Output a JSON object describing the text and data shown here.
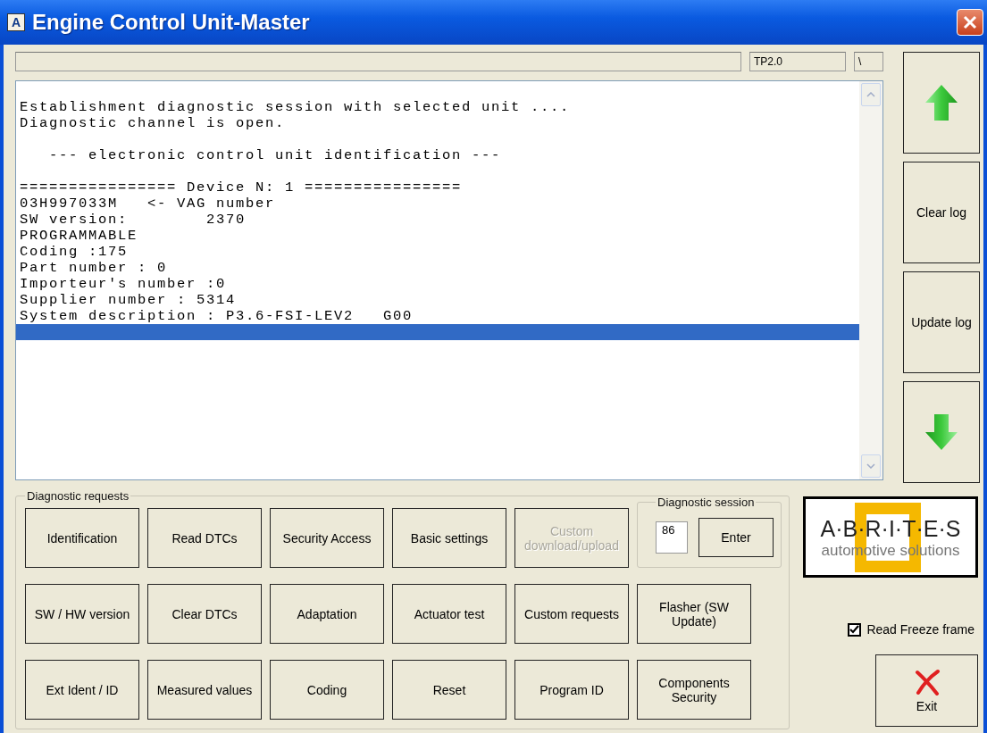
{
  "window": {
    "title": "Engine Control Unit-Master",
    "app_icon_letter": "A"
  },
  "status_bar": {
    "fields": [
      "TP2.0",
      "\\"
    ]
  },
  "log": {
    "blocks": [
      [
        "Establishment diagnostic session with selected unit ....",
        "Diagnostic channel is open."
      ],
      [
        "   --- electronic control unit identification ---"
      ],
      [
        "================ Device N: 1 ================",
        "03H997033M   <- VAG number",
        "SW version:        2370",
        "PROGRAMMABLE",
        "Coding :175",
        "Part number : 0",
        "Importeur's number :0",
        "Supplier number : 5314",
        "System description : P3.6-FSI-LEV2   G00"
      ]
    ],
    "caret_row_selected": true
  },
  "side_buttons": [
    {
      "kind": "up"
    },
    {
      "kind": "text",
      "label": "Clear log"
    },
    {
      "kind": "text",
      "label": "Update log"
    },
    {
      "kind": "down"
    }
  ],
  "diagnostic_requests": {
    "title": "Diagnostic requests",
    "buttons": [
      {
        "label": "Identification",
        "disabled": false
      },
      {
        "label": "Read DTCs",
        "disabled": false
      },
      {
        "label": "Security Access",
        "disabled": false
      },
      {
        "label": "Basic settings",
        "disabled": false
      },
      {
        "label": "Custom download/upload",
        "disabled": true
      },
      {
        "label": "SW / HW version",
        "disabled": false
      },
      {
        "label": "Clear DTCs",
        "disabled": false
      },
      {
        "label": "Adaptation",
        "disabled": false
      },
      {
        "label": "Actuator test",
        "disabled": false
      },
      {
        "label": "Custom requests",
        "disabled": false
      },
      {
        "label": "Flasher (SW Update)",
        "disabled": false
      },
      {
        "label": "Ext Ident / ID",
        "disabled": false
      },
      {
        "label": "Measured values",
        "disabled": false
      },
      {
        "label": "Coding",
        "disabled": false
      },
      {
        "label": "Reset",
        "disabled": false
      },
      {
        "label": "Program ID",
        "disabled": false
      },
      {
        "label": "Components Security",
        "disabled": false
      }
    ]
  },
  "diagnostic_session": {
    "title": "Diagnostic session",
    "value": "86",
    "button": "Enter"
  },
  "logo": {
    "wordmark": "A·B·R·I·T·E·S",
    "tagline": "automotive solutions"
  },
  "read_freeze_frame": {
    "label": "Read Freeze frame",
    "checked": true
  },
  "exit_button": {
    "label": "Exit"
  }
}
